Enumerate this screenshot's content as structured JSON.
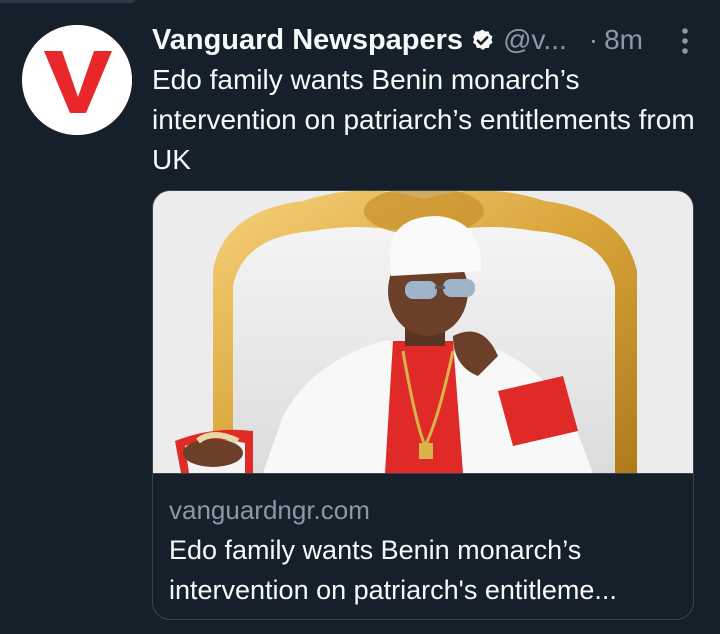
{
  "tweet": {
    "author_name": "Vanguard Newspapers",
    "handle": "@v...",
    "separator": "·",
    "time": "8m",
    "text": "Edo family wants Benin monarch’s intervention on patriarch’s entitlements from UK",
    "avatar_letter": "V",
    "verified_icon": "verified-badge-icon",
    "more_icon": "more-vertical-icon"
  },
  "card": {
    "domain": "vanguardngr.com",
    "title": "Edo family wants Benin monarch’s intervention on patriarch's entitleme..."
  },
  "colors": {
    "background": "#15202b",
    "text_primary": "#f7f9f9",
    "text_secondary": "#8b98a5",
    "border": "#38444d",
    "avatar_red": "#e8272b"
  }
}
